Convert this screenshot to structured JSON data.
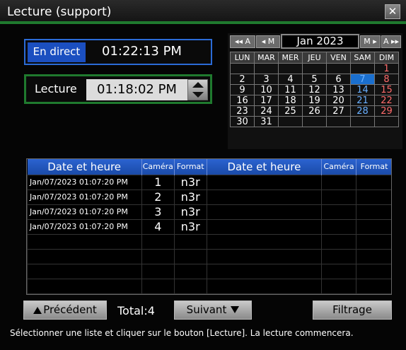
{
  "window": {
    "title": "Lecture (support)",
    "close_label": "✕"
  },
  "live": {
    "label": "En direct",
    "time": "01:22:13 PM"
  },
  "playback": {
    "label": "Lecture",
    "time": "01:18:02 PM"
  },
  "calendar": {
    "nav": {
      "prev_year": "◂◂ A",
      "prev_month": "◂ M",
      "month": "Jan 2023",
      "next_month": "M ▸",
      "next_year": "A ▸▸"
    },
    "days": [
      "LUN",
      "MAR",
      "MER",
      "JEU",
      "VEN",
      "SAM",
      "DIM"
    ],
    "weeks": [
      [
        "",
        "",
        "",
        "",
        "",
        "",
        "1"
      ],
      [
        "2",
        "3",
        "4",
        "5",
        "6",
        "7",
        "8"
      ],
      [
        "9",
        "10",
        "11",
        "12",
        "13",
        "14",
        "15"
      ],
      [
        "16",
        "17",
        "18",
        "19",
        "20",
        "21",
        "22"
      ],
      [
        "23",
        "24",
        "25",
        "26",
        "27",
        "28",
        "29"
      ],
      [
        "30",
        "31",
        "",
        "",
        "",
        "",
        ""
      ]
    ],
    "selected": "7"
  },
  "table": {
    "headers": [
      "Date et heure",
      "Caméra",
      "Format",
      "Date et heure",
      "Caméra",
      "Format"
    ],
    "rows": [
      {
        "datetime": "Jan/07/2023  01:07:20 PM",
        "camera": "1",
        "format": "n3r"
      },
      {
        "datetime": "Jan/07/2023  01:07:20 PM",
        "camera": "2",
        "format": "n3r"
      },
      {
        "datetime": "Jan/07/2023  01:07:20 PM",
        "camera": "3",
        "format": "n3r"
      },
      {
        "datetime": "Jan/07/2023  01:07:20 PM",
        "camera": "4",
        "format": "n3r"
      }
    ]
  },
  "footer": {
    "prev_label": "Précédent",
    "total": "Total:4",
    "next_label": "Suivant",
    "filter_label": "Filtrage",
    "hint": "Sélectionner une liste et cliquer sur le bouton [Lecture]. La lecture commencera."
  },
  "colors": {
    "accent_green": "#1f7a2e",
    "accent_blue": "#1b4fc0",
    "saturday": "#6ab0ff",
    "sunday": "#ff6b6b"
  }
}
